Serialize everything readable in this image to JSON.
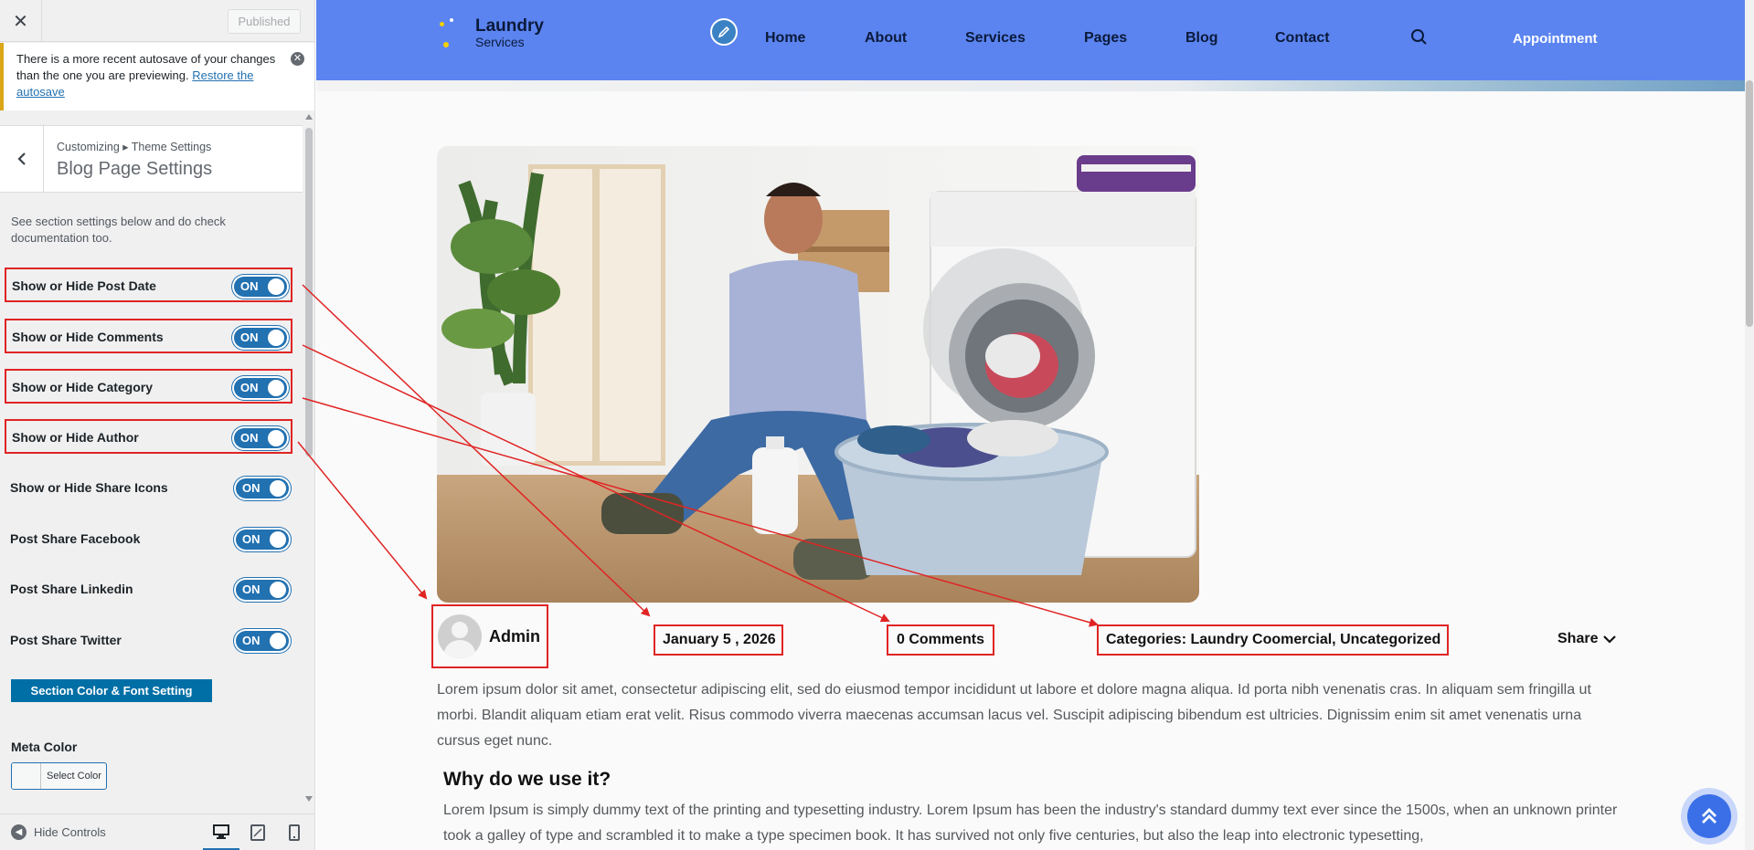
{
  "sidebar": {
    "close_icon": "close-icon",
    "publish_label": "Published",
    "autosave": {
      "message": "There is a more recent autosave of your changes than the one you are previewing.",
      "link": "Restore the autosave"
    },
    "breadcrumb": "Customizing ▸ Theme Settings",
    "section_title": "Blog Page Settings",
    "description": "See section settings below and do check documentation too.",
    "settings": [
      {
        "label": "Show or Hide Post Date",
        "state": "ON"
      },
      {
        "label": "Show or Hide Comments",
        "state": "ON"
      },
      {
        "label": "Show or Hide Category",
        "state": "ON"
      },
      {
        "label": "Show or Hide Author",
        "state": "ON"
      },
      {
        "label": "Show or Hide Share Icons",
        "state": "ON"
      },
      {
        "label": "Post Share Facebook",
        "state": "ON"
      },
      {
        "label": "Post Share Linkedin",
        "state": "ON"
      },
      {
        "label": "Post Share Twitter",
        "state": "ON"
      }
    ],
    "color_font_button": "Section Color & Font Setting",
    "meta_color_label": "Meta Color",
    "select_color": "Select Color",
    "hide_controls": "Hide Controls"
  },
  "site": {
    "logo_title": "Laundry",
    "logo_subtitle": "Services",
    "nav": [
      "Home",
      "About",
      "Services",
      "Pages",
      "Blog",
      "Contact"
    ],
    "appointment": "Appointment",
    "header_color": "#5b84f0"
  },
  "post": {
    "author": "Admin",
    "date": "January 5 , 2026",
    "comments": "0 Comments",
    "categories": "Categories: Laundry Coomercial, Uncategorized",
    "share": "Share",
    "body": "Lorem ipsum dolor sit amet, consectetur adipiscing elit, sed do eiusmod tempor incididunt ut labore et dolore magna aliqua. Id porta nibh venenatis cras. In aliquam sem fringilla ut morbi. Blandit aliquam etiam erat velit. Risus commodo viverra maecenas accumsan lacus vel. Suscipit adipiscing bibendum est ultricies. Dignissim enim sit amet venenatis urna cursus eget nunc.",
    "heading": "Why do we use it?",
    "body2": "Lorem Ipsum is simply dummy text of the printing and typesetting industry. Lorem Ipsum has been the industry's standard dummy text ever since the 1500s, when an unknown printer took a galley of type and scrambled it to make a type specimen book. It has survived not only five centuries, but also the leap into electronic typesetting,"
  },
  "colors": {
    "accent": "#2271b1",
    "annotation": "#e02424",
    "autosave_border": "#dba617"
  }
}
